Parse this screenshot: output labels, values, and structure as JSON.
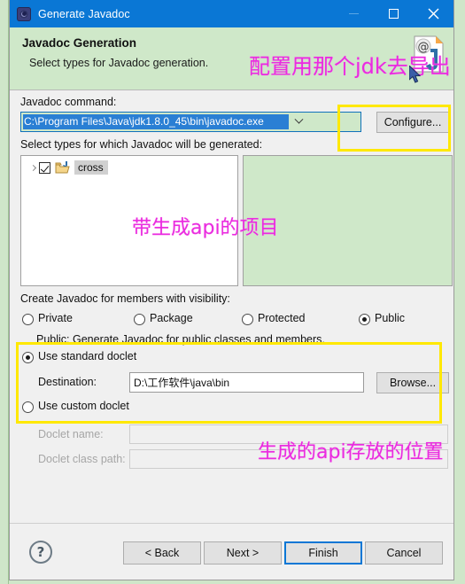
{
  "window": {
    "title": "Generate Javadoc",
    "icon": "gear-icon",
    "minimize": "–",
    "maximize": "□",
    "close": "×"
  },
  "header": {
    "title": "Javadoc Generation",
    "subtitle": "Select types for Javadoc generation.",
    "icon": "javadoc-page-icon"
  },
  "form": {
    "command_label": "Javadoc command:",
    "command_value": "C:\\Program Files\\Java\\jdk1.8.0_45\\bin\\javadoc.exe",
    "configure_button": "Configure...",
    "select_types_label": "Select types for which Javadoc will be generated:",
    "tree": {
      "items": [
        {
          "label": "cross",
          "checked": true,
          "expandable": true
        }
      ]
    },
    "visibility_label": "Create Javadoc for members with visibility:",
    "visibility_options": [
      {
        "label": "Private",
        "selected": false
      },
      {
        "label": "Package",
        "selected": false
      },
      {
        "label": "Protected",
        "selected": false
      },
      {
        "label": "Public",
        "selected": true
      }
    ],
    "visibility_description": "Public: Generate Javadoc for public classes and members.",
    "standard_doclet_label": "Use standard doclet",
    "standard_doclet_selected": true,
    "destination_label": "Destination:",
    "destination_value": "D:\\工作软件\\java\\bin",
    "browse_button": "Browse...",
    "custom_doclet_label": "Use custom doclet",
    "custom_doclet_selected": false,
    "doclet_name_label": "Doclet name:",
    "doclet_name_value": "",
    "doclet_classpath_label": "Doclet class path:",
    "doclet_classpath_value": ""
  },
  "footer": {
    "help": "?",
    "back": "< Back",
    "next": "Next >",
    "finish": "Finish",
    "cancel": "Cancel"
  },
  "annotations": [
    {
      "text": "配置用那个jdk去导出"
    },
    {
      "text": "带生成api的项目"
    },
    {
      "text": "生成的api存放的位置"
    }
  ],
  "colors": {
    "titlebar": "#0a77d5",
    "header_green": "#cfe8c9",
    "highlight_yellow": "#ffe800",
    "annotation_pink": "#e92ce0",
    "selection_blue": "#2a7fd4"
  }
}
